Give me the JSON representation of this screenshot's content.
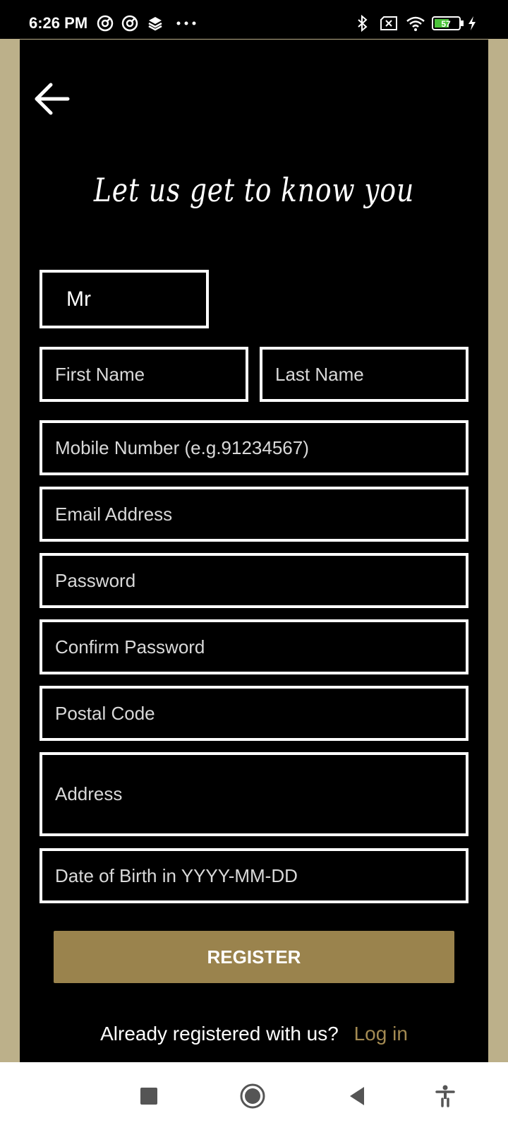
{
  "status_bar": {
    "time": "6:26 PM",
    "battery_level": "57",
    "left_icons": [
      "at-sign-icon",
      "at-sign-icon",
      "layers-icon",
      "more-dots-icon"
    ],
    "right_icons": [
      "bluetooth-icon",
      "no-sim-icon",
      "wifi-icon",
      "battery-icon",
      "charging-icon"
    ]
  },
  "colors": {
    "background": "#000000",
    "band": "#bcb08a",
    "accent": "#9a834d",
    "link": "#a38a52",
    "field_border": "#ffffff"
  },
  "header": {
    "back_icon": "arrow-left-icon",
    "title": "Let us get to know you"
  },
  "form": {
    "salutation": "Mr",
    "first_name_placeholder": "First Name",
    "last_name_placeholder": "Last Name",
    "mobile_placeholder": "Mobile Number (e.g.91234567)",
    "email_placeholder": "Email Address",
    "password_placeholder": "Password",
    "confirm_password_placeholder": "Confirm Password",
    "postal_code_placeholder": "Postal Code",
    "address_placeholder": "Address",
    "dob_placeholder": "Date of Birth in YYYY-MM-DD",
    "register_label": "REGISTER"
  },
  "footer": {
    "prompt": "Already registered with us?",
    "login_link": "Log in"
  },
  "nav_bar": {
    "buttons": [
      "recent-apps-icon",
      "home-icon",
      "back-icon",
      "accessibility-icon"
    ]
  }
}
